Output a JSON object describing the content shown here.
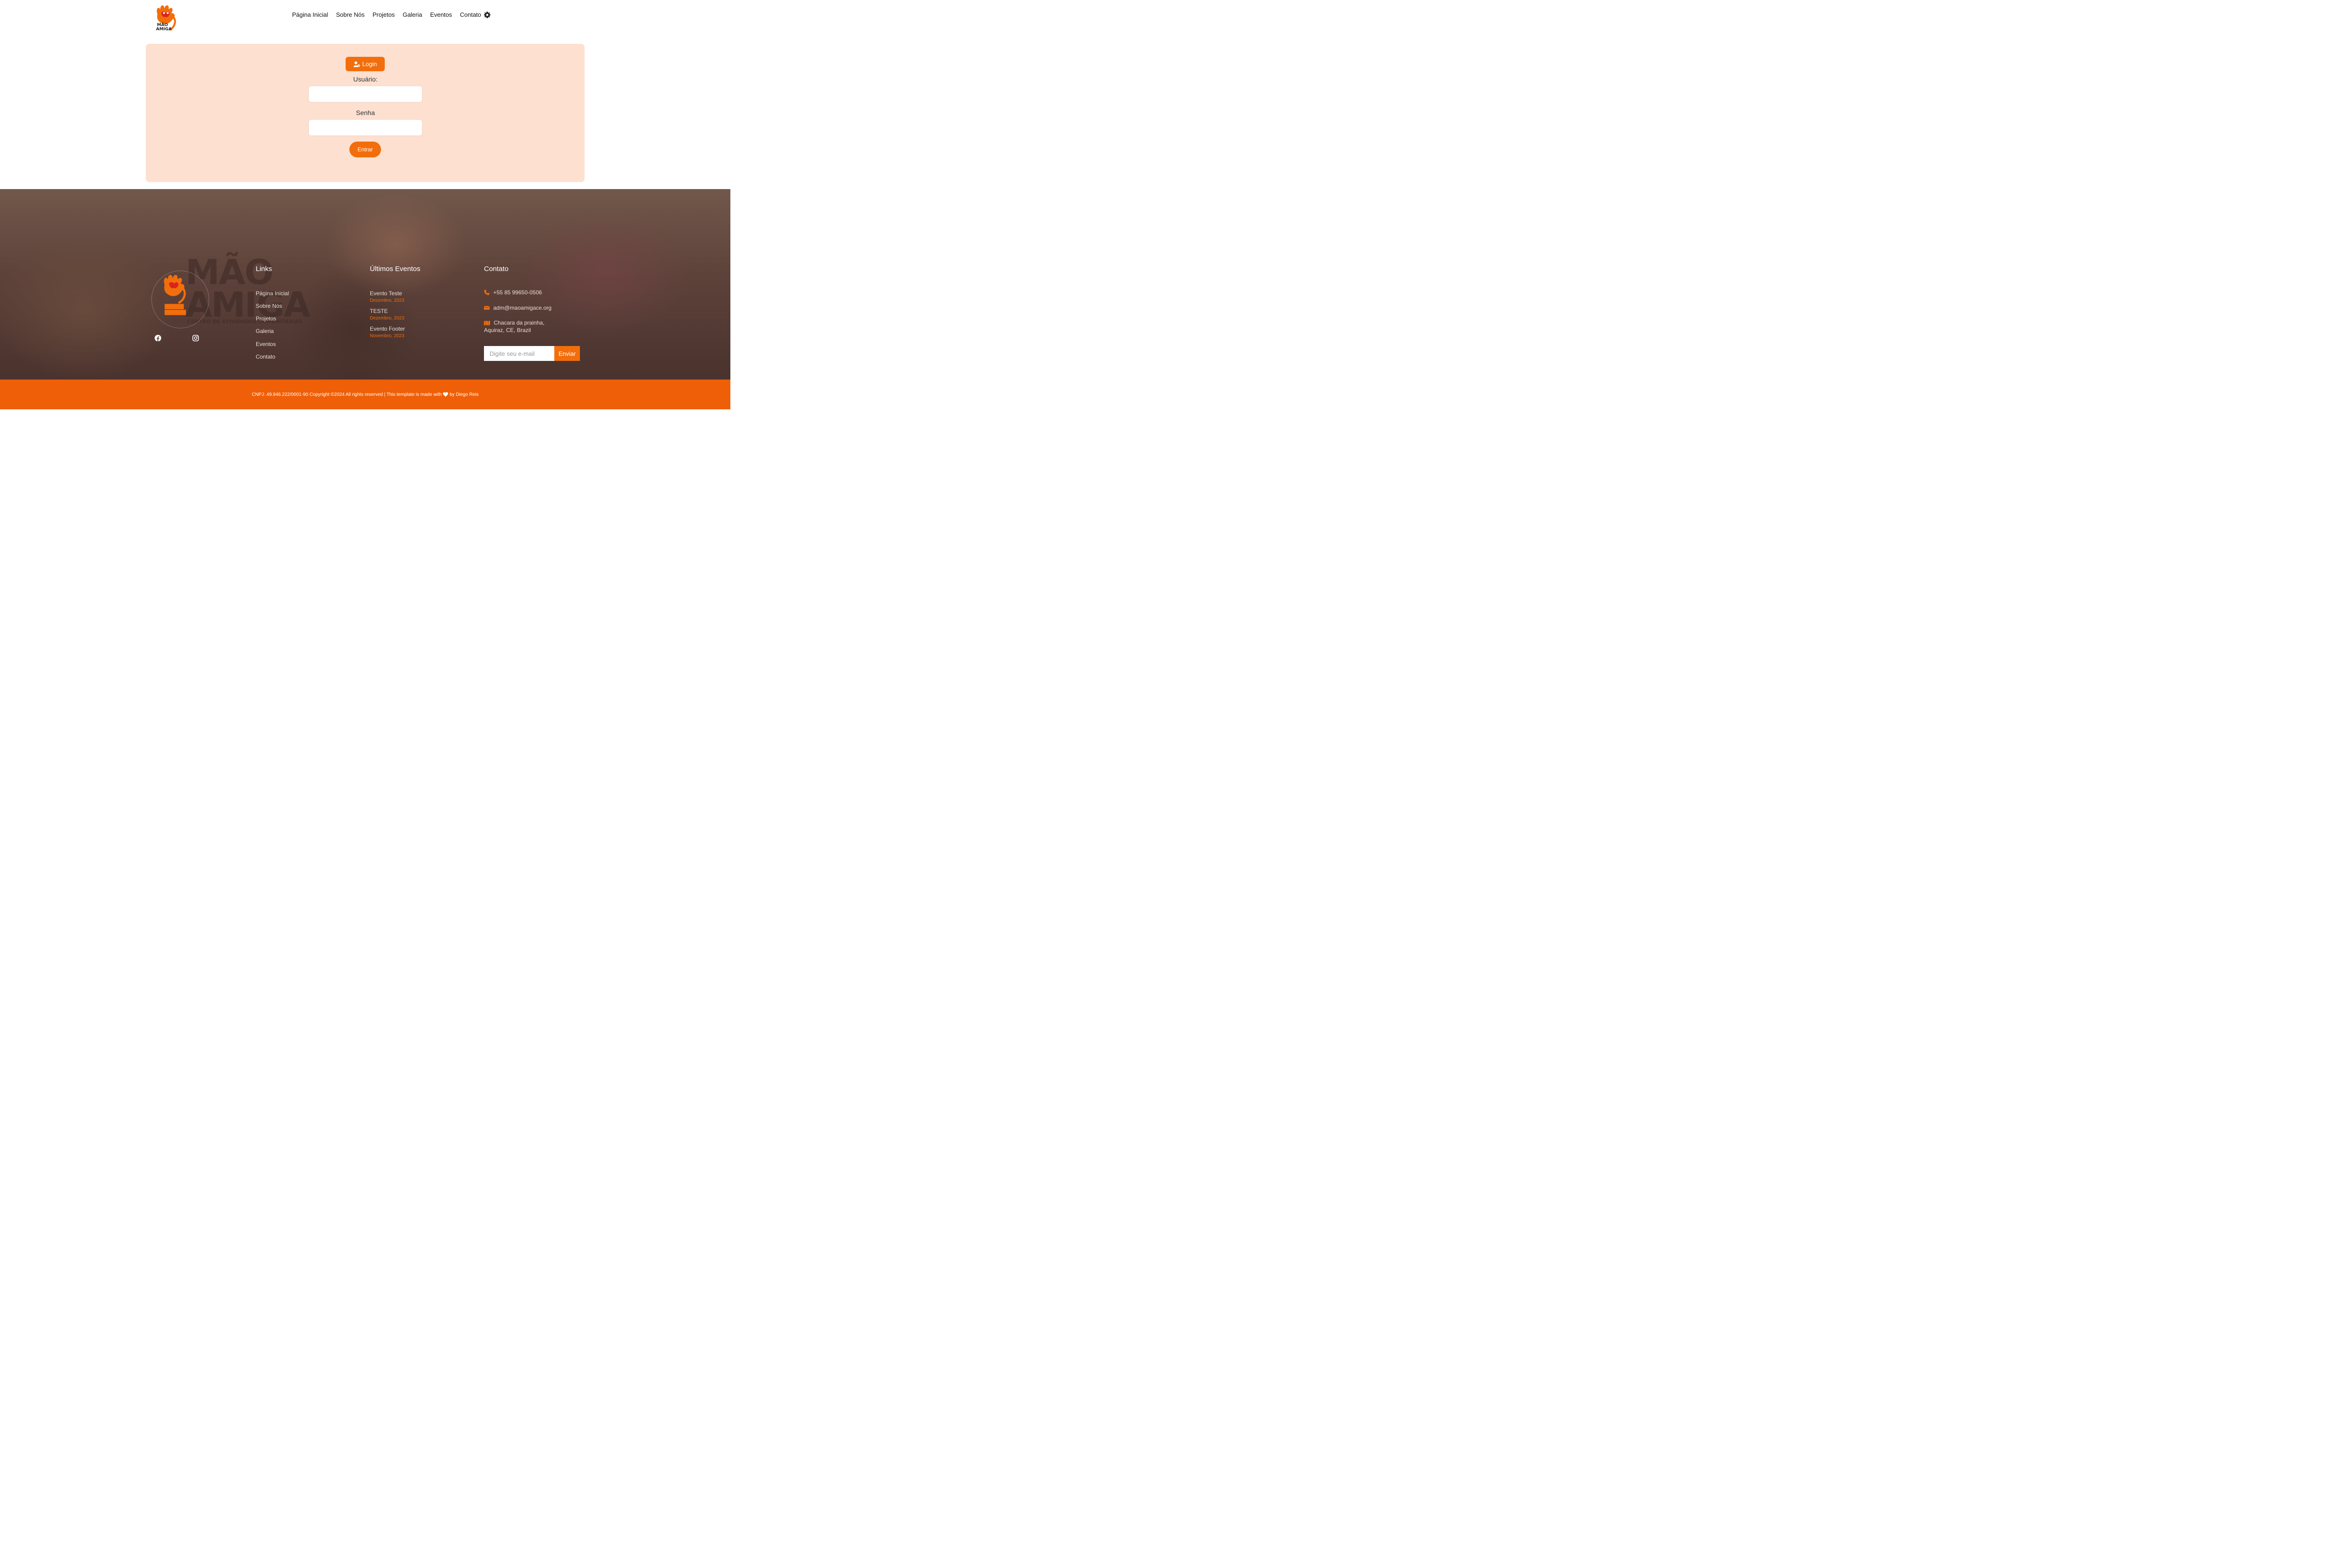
{
  "brand": {
    "logo_alt": "Mão Amiga",
    "logo_text": "MÃO AMIGA",
    "accent_color": "#f26e0c",
    "panel_color": "#fde0d0"
  },
  "nav": {
    "items": [
      "Página Inicial",
      "Sobre Nós",
      "Projetos",
      "Galeria",
      "Eventos",
      "Contato"
    ],
    "settings_icon": "gear-icon"
  },
  "login": {
    "badge_label": "Login",
    "badge_icon": "user-gear-icon",
    "user_label": "Usuário:",
    "user_value": "",
    "password_label": "Senha",
    "password_value": "",
    "submit_label": "Entrar"
  },
  "footer": {
    "banner_word_1": "MÃO",
    "banner_word_2": "AMIGA",
    "banner_sub": "CENTRO DE ATIVIDADES COMUNITÁRIAS",
    "social": [
      "facebook-icon",
      "instagram-icon"
    ],
    "links_title": "Links",
    "links": [
      "Página Inicial",
      "Sobre Nós",
      "Projetos",
      "Galeria",
      "Eventos",
      "Contato"
    ],
    "events_title": "Últimos Eventos",
    "events": [
      {
        "title": "Evento Teste",
        "date": "Dezembro, 2023"
      },
      {
        "title": "TESTE",
        "date": "Dezembro, 2023"
      },
      {
        "title": "Evento Footer",
        "date": "Novembro, 2023"
      }
    ],
    "contact_title": "Contato",
    "phone": "+55 85 99650-0506",
    "email": "adm@maoamigace.org",
    "address_line1": "Chacara da prainha,",
    "address_line2": "Aquiraz, CE, Brazil",
    "newsletter_placeholder": "Digite seu e-mail",
    "newsletter_button": "Enviar"
  },
  "copyright": {
    "text_before": "CNPJ: 49.946.222/0001-90 Copyright ©2024 All rights reserved | This template is made with",
    "text_after": "by Diego Reis"
  }
}
